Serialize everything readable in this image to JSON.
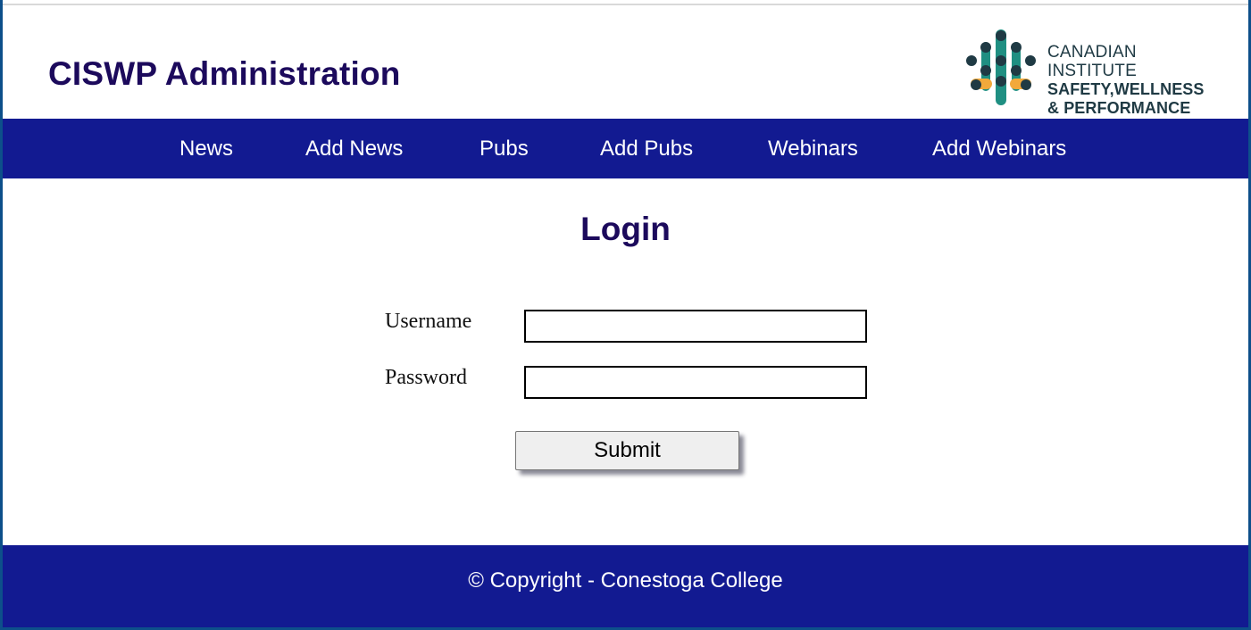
{
  "header": {
    "title": "CISWP Administration",
    "logo": {
      "line1": "CANADIAN INSTITUTE",
      "line2": "SAFETY,WELLNESS",
      "line3": "& PERFORMANCE",
      "colors": {
        "teal": "#1f8f82",
        "dark": "#1f3a44",
        "orange": "#f2a93b"
      }
    }
  },
  "nav": {
    "items": [
      {
        "label": "News"
      },
      {
        "label": "Add News"
      },
      {
        "label": "Pubs"
      },
      {
        "label": "Add Pubs"
      },
      {
        "label": "Webinars"
      },
      {
        "label": "Add Webinars"
      }
    ]
  },
  "login": {
    "title": "Login",
    "username_label": "Username",
    "username_value": "",
    "password_label": "Password",
    "password_value": "",
    "submit_label": "Submit"
  },
  "footer": {
    "text": "© Copyright - Conestoga College"
  },
  "colors": {
    "nav_bg": "#121a91",
    "title": "#1c0a5c",
    "frame_border": "#0d4f8a"
  }
}
